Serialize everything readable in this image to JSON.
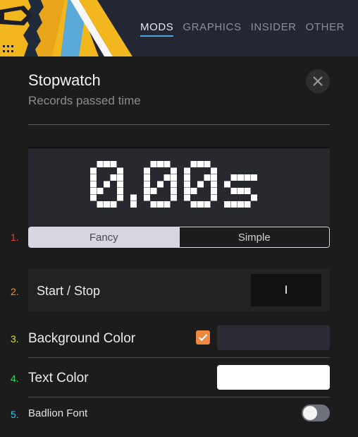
{
  "nav": {
    "tabs": [
      {
        "label": "MODS",
        "active": true
      },
      {
        "label": "GRAPHICS",
        "active": false
      },
      {
        "label": "INSIDER",
        "active": false
      },
      {
        "label": "OTHER",
        "active": false
      }
    ]
  },
  "panel": {
    "title": "Stopwatch",
    "subtitle": "Records passed time",
    "close_icon": "close-icon"
  },
  "preview": {
    "display_text": "0.00s"
  },
  "settings": {
    "style": {
      "number": "1.",
      "options": [
        "Fancy",
        "Simple"
      ],
      "selected": "Fancy"
    },
    "keybind": {
      "number": "2.",
      "label": "Start / Stop",
      "key": "I"
    },
    "background_color": {
      "number": "3.",
      "label": "Background Color",
      "enabled": true,
      "swatch": "#2b2c33"
    },
    "text_color": {
      "number": "4.",
      "label": "Text Color",
      "swatch": "#ffffff"
    },
    "badlion_font": {
      "number": "5.",
      "label": "Badlion Font",
      "enabled": false
    }
  },
  "colors": {
    "accent": "#4aa7dc",
    "checkbox": "#f0873e",
    "background": "#1c1c1c"
  }
}
